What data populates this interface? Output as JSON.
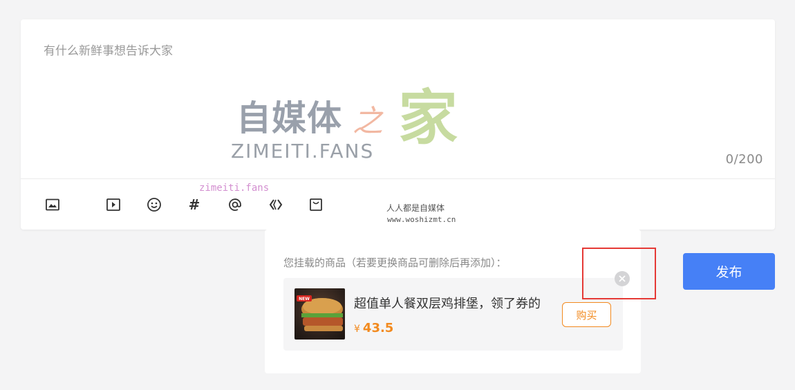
{
  "editor": {
    "placeholder": "有什么新鲜事想告诉大家",
    "counter": "0/200"
  },
  "toolbar": {
    "items": [
      {
        "name": "image-icon"
      },
      {
        "name": "video-icon"
      },
      {
        "name": "emoji-icon"
      },
      {
        "name": "topic-icon",
        "label": "#"
      },
      {
        "name": "mention-icon"
      },
      {
        "name": "code-icon"
      },
      {
        "name": "product-bag-icon"
      }
    ]
  },
  "watermarks": {
    "logo": "自媒体",
    "logo_zhi": "之",
    "logo_jia": "家",
    "logo_fans": "ZIMEITI.FANS",
    "small": "zimeiti.fans",
    "site_name": "人人都是自媒体",
    "site_url": "www.woshizmt.cn"
  },
  "popover": {
    "title": "您挂载的商品（若要更换商品可删除后再添加）：",
    "product": {
      "name": "超值单人餐双层鸡排堡，领了券的",
      "currency": "¥",
      "price": "43.5",
      "badge": "NEW",
      "buy_label": "购买"
    }
  },
  "publish": {
    "label": "发布"
  },
  "colors": {
    "primary": "#4680f6",
    "price": "#f28a1f",
    "highlight": "#e53935"
  }
}
